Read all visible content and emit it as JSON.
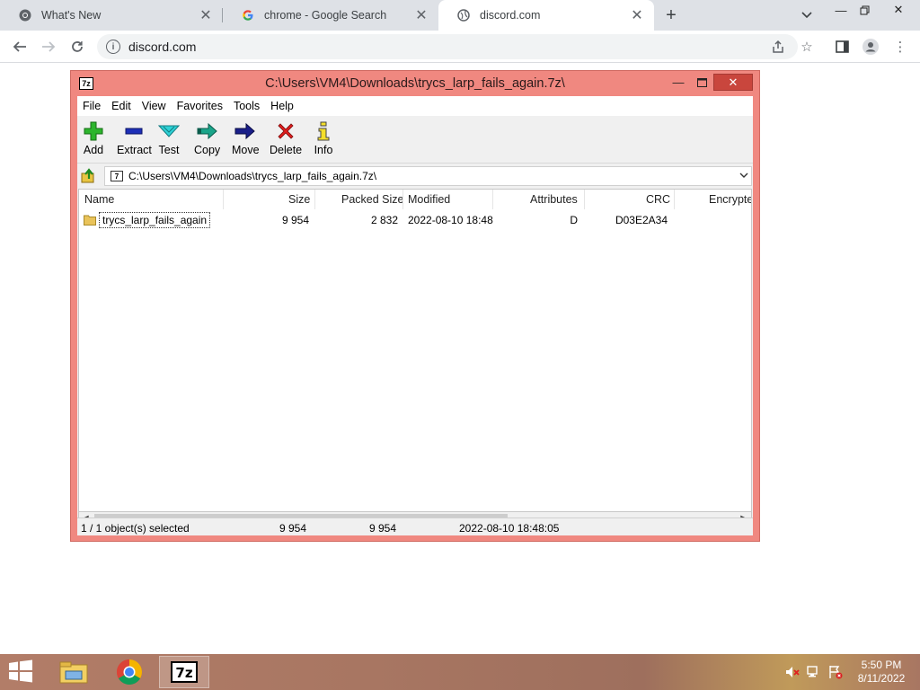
{
  "browser": {
    "tabs": [
      {
        "title": "What's New",
        "favicon": "chrome-icon"
      },
      {
        "title": "chrome - Google Search",
        "favicon": "google-icon"
      },
      {
        "title": "discord.com",
        "favicon": "globe-icon",
        "active": true
      }
    ],
    "url": "discord.com"
  },
  "sevenzip": {
    "title": "C:\\Users\\VM4\\Downloads\\trycs_larp_fails_again.7z\\",
    "menu": [
      "File",
      "Edit",
      "View",
      "Favorites",
      "Tools",
      "Help"
    ],
    "toolbar": [
      "Add",
      "Extract",
      "Test",
      "Copy",
      "Move",
      "Delete",
      "Info"
    ],
    "address": "C:\\Users\\VM4\\Downloads\\trycs_larp_fails_again.7z\\",
    "columns": [
      "Name",
      "Size",
      "Packed Size",
      "Modified",
      "Attributes",
      "CRC",
      "Encrypte"
    ],
    "rows": [
      {
        "name": "trycs_larp_fails_again",
        "size": "9 954",
        "packed": "2 832",
        "modified": "2022-08-10 18:48",
        "attributes": "D",
        "crc": "D03E2A34",
        "encrypted": ""
      }
    ],
    "status": {
      "selected": "1 / 1 object(s) selected",
      "size": "9 954",
      "packed": "9 954",
      "modified": "2022-08-10 18:48:05"
    }
  },
  "taskbar": {
    "time": "5:50 PM",
    "date": "8/11/2022"
  },
  "colors": {
    "sevenzip_frame": "#f08880",
    "close_button": "#c9463d",
    "taskbar": "#a87662"
  }
}
